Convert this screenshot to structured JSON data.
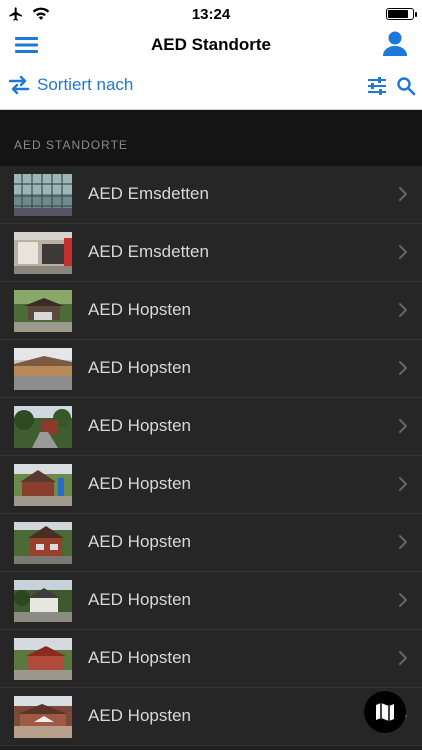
{
  "status_bar": {
    "time": "13:24",
    "battery_level": 0.9
  },
  "nav": {
    "title": "AED Standorte"
  },
  "toolbar": {
    "sort_label": "Sortiert nach"
  },
  "section": {
    "header": "AED STANDORTE"
  },
  "locations": [
    {
      "name": "AED Emsdetten",
      "thumb": "glass-facade"
    },
    {
      "name": "AED Emsdetten",
      "thumb": "storefront"
    },
    {
      "name": "AED Hopsten",
      "thumb": "carport"
    },
    {
      "name": "AED Hopsten",
      "thumb": "building-wide"
    },
    {
      "name": "AED Hopsten",
      "thumb": "street-trees"
    },
    {
      "name": "AED Hopsten",
      "thumb": "brick-house"
    },
    {
      "name": "AED Hopsten",
      "thumb": "brick-house-2"
    },
    {
      "name": "AED Hopsten",
      "thumb": "white-house"
    },
    {
      "name": "AED Hopsten",
      "thumb": "red-roof"
    },
    {
      "name": "AED Hopsten",
      "thumb": "umbrella-yard"
    }
  ],
  "colors": {
    "accent": "#1e78d8",
    "row_bg": "#262626",
    "text": "#d8d8d8"
  }
}
